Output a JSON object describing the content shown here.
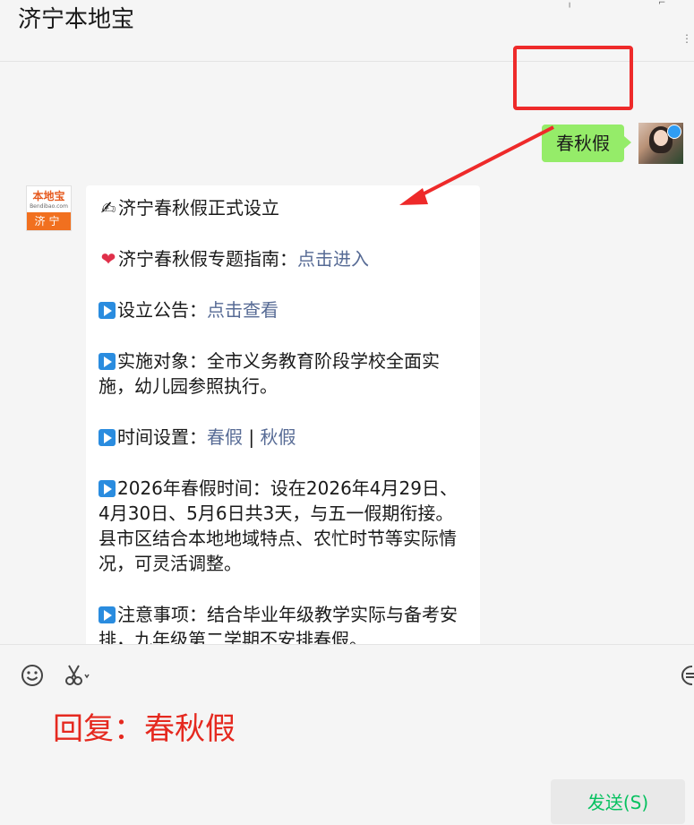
{
  "header": {
    "title": "济宁本地宝"
  },
  "self_message": {
    "text": "春秋假"
  },
  "bot": {
    "avatar": {
      "logo_text": "本地宝",
      "logo_sub": "Bendibao.com",
      "city": "济宁"
    },
    "lines": {
      "l1": "济宁春秋假正式设立",
      "l2_prefix": "济宁春秋假专题指南：",
      "l2_link": "点击进入",
      "l3_prefix": "设立公告：",
      "l3_link": "点击查看",
      "l4": "实施对象：全市义务教育阶段学校全面实施，幼儿园参照执行。",
      "l5_prefix": "时间设置：",
      "l5_link1": "春假",
      "l5_sep": " | ",
      "l5_link2": "秋假",
      "l6a": "2026年春假时间：设在2026年4月29日、4月30日、5月6日共3天，与五一假期衔接。",
      "l6b": "县市区结合本地地域特点、农忙时节等实际情况，可灵活调整。",
      "l7": "注意事项：结合毕业年级教学实际与备考安排，九年级第二学期不安排春假。"
    },
    "emoji": {
      "writing": "✍",
      "heart": "❤"
    }
  },
  "input": {
    "reply_text": "回复：春秋假",
    "send_label": "发送(S)"
  },
  "icons": {
    "emoji": "smiley-icon",
    "scissors": "scissors-icon",
    "chat": "chat-bubble-icon"
  },
  "colors": {
    "bubble_green": "#95ec69",
    "link_blue": "#576b95",
    "play_blue": "#2a8cdf",
    "annotation_red": "#ee2a2a",
    "send_green": "#07c160"
  }
}
